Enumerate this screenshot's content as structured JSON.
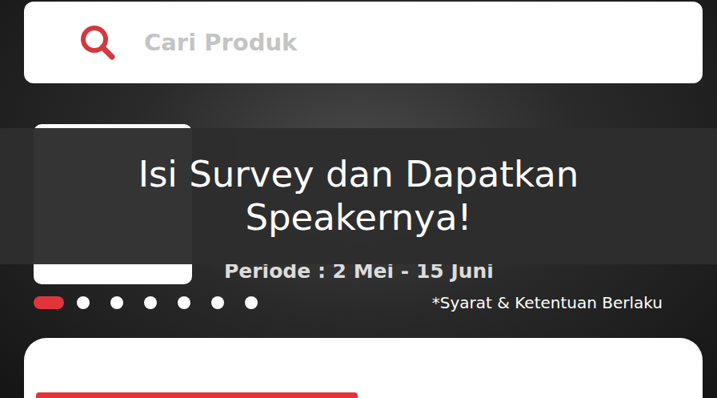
{
  "search": {
    "placeholder": "Cari Produk"
  },
  "banner": {
    "period": "Periode : 2 Mei - 15 Juni",
    "terms": "*Syarat & Ketentuan Berlaku",
    "dots": [
      {
        "selected": true
      },
      {
        "selected": false
      },
      {
        "selected": false
      },
      {
        "selected": false
      },
      {
        "selected": false
      },
      {
        "selected": false
      },
      {
        "selected": false
      }
    ]
  },
  "overlay": {
    "title": "Isi Survey dan Dapatkan Speakernya!"
  },
  "bottom_card": {
    "bar": {
      "level": 0.5
    }
  }
}
